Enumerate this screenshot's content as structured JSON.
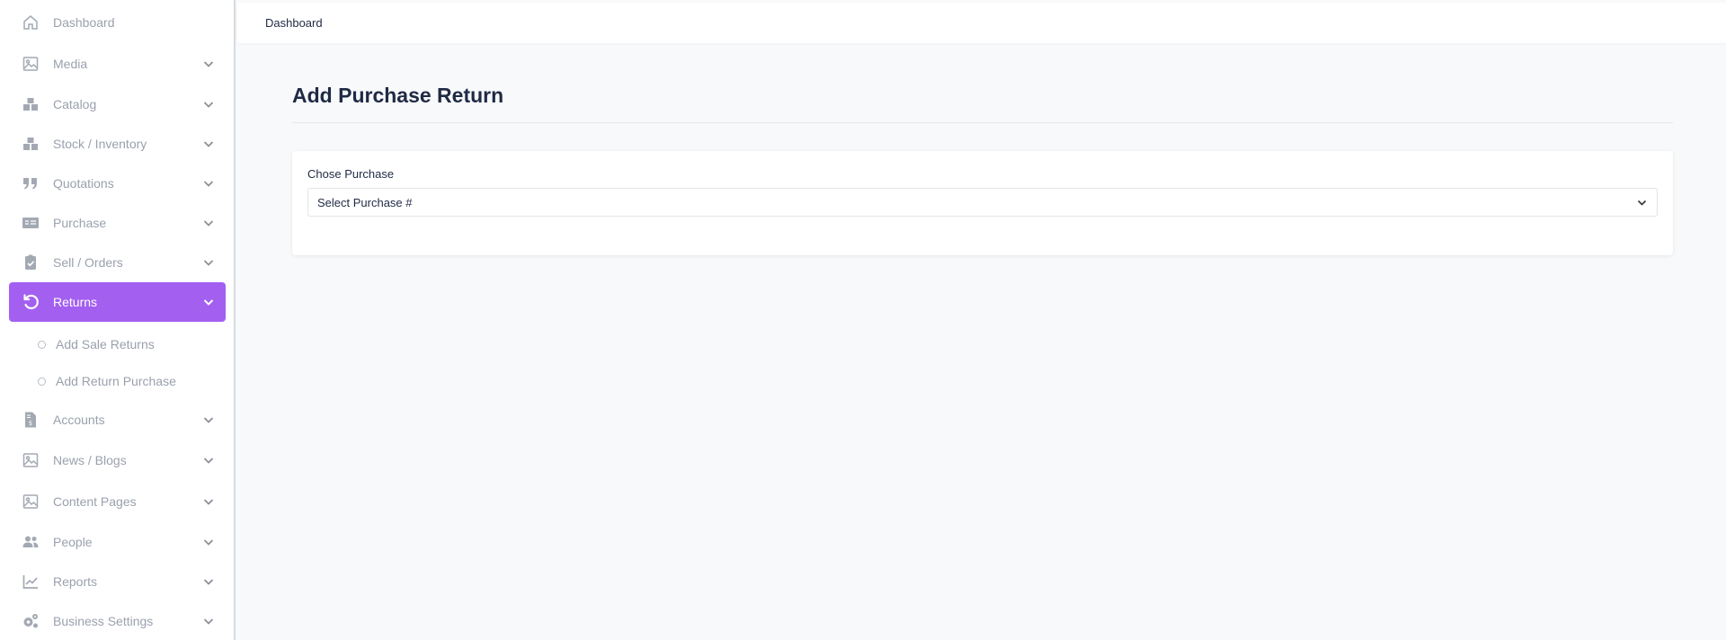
{
  "sidebar": {
    "items": [
      {
        "label": "Dashboard",
        "icon": "home-icon",
        "has_chevron": false
      },
      {
        "label": "Media",
        "icon": "image-icon",
        "has_chevron": true
      },
      {
        "label": "Catalog",
        "icon": "boxes-icon",
        "has_chevron": true
      },
      {
        "label": "Stock / Inventory",
        "icon": "boxes-icon",
        "has_chevron": true
      },
      {
        "label": "Quotations",
        "icon": "quote-icon",
        "has_chevron": true
      },
      {
        "label": "Purchase",
        "icon": "money-check-icon",
        "has_chevron": true
      },
      {
        "label": "Sell / Orders",
        "icon": "clipboard-check-icon",
        "has_chevron": true
      },
      {
        "label": "Returns",
        "icon": "undo-icon",
        "has_chevron": true,
        "active": true
      },
      {
        "label": "Accounts",
        "icon": "file-invoice-dollar-icon",
        "has_chevron": true
      },
      {
        "label": "News / Blogs",
        "icon": "image-icon",
        "has_chevron": true
      },
      {
        "label": "Content Pages",
        "icon": "image-icon",
        "has_chevron": true
      },
      {
        "label": "People",
        "icon": "users-icon",
        "has_chevron": true
      },
      {
        "label": "Reports",
        "icon": "chart-line-icon",
        "has_chevron": true
      },
      {
        "label": "Business Settings",
        "icon": "cogs-icon",
        "has_chevron": true
      }
    ],
    "returns_sub": [
      {
        "label": "Add Sale Returns"
      },
      {
        "label": "Add Return Purchase"
      }
    ]
  },
  "header": {
    "breadcrumb": "Dashboard"
  },
  "main": {
    "title": "Add Purchase Return",
    "form": {
      "label": "Chose Purchase",
      "select_value": "Select Purchase #"
    }
  },
  "colors": {
    "accent": "#a35ff0",
    "background": "#f8f9fb",
    "text": "#1f2a44",
    "muted": "#9aa1ad"
  }
}
